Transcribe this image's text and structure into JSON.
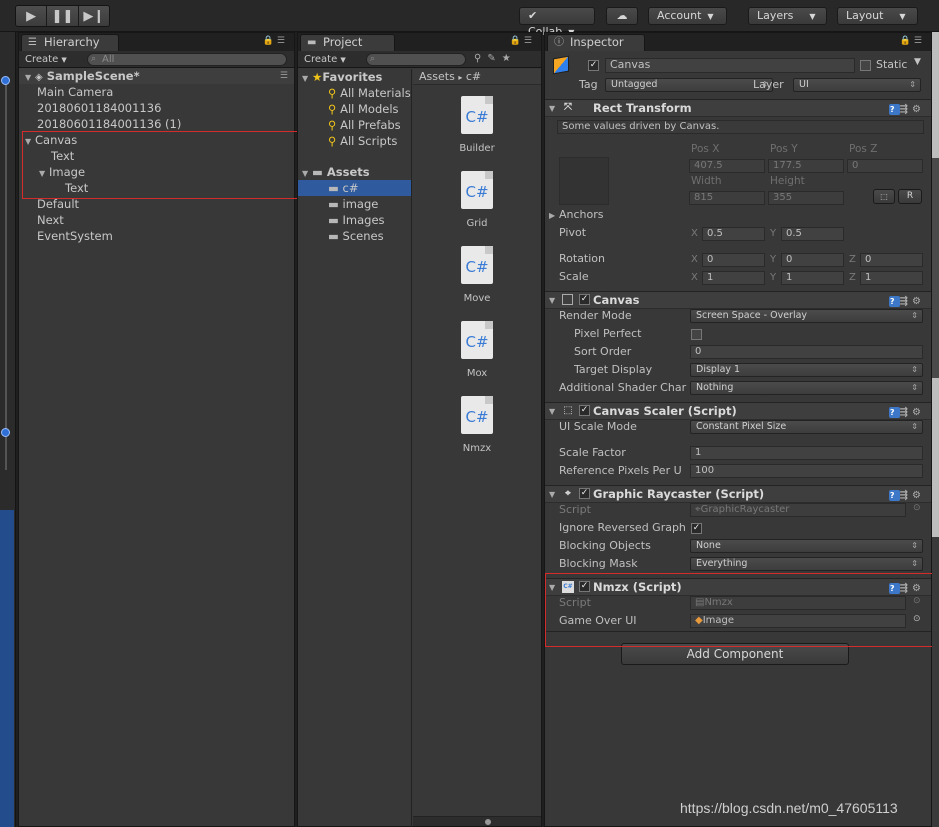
{
  "toolbar": {
    "collab": "Collab",
    "account": "Account",
    "layers": "Layers",
    "layout": "Layout"
  },
  "hierarchy": {
    "tab": "Hierarchy",
    "create": "Create",
    "search_placeholder": "All",
    "scene": "SampleScene*",
    "items": [
      {
        "label": "Main Camera",
        "indent": 0
      },
      {
        "label": "20180601184001136",
        "indent": 0
      },
      {
        "label": "20180601184001136 (1)",
        "indent": 0
      },
      {
        "label": "Canvas",
        "indent": 0
      },
      {
        "label": "Text",
        "indent": 1
      },
      {
        "label": "Image",
        "indent": 1
      },
      {
        "label": "Text",
        "indent": 2
      },
      {
        "label": "Default",
        "indent": 0
      },
      {
        "label": "Next",
        "indent": 0
      },
      {
        "label": "EventSystem",
        "indent": 0
      }
    ]
  },
  "project": {
    "tab": "Project",
    "create": "Create",
    "favorites_label": "Favorites",
    "favorites": [
      "All Materials",
      "All Models",
      "All Prefabs",
      "All Scripts"
    ],
    "assets_label": "Assets",
    "folders": [
      "c#",
      "image",
      "Images",
      "Scenes"
    ],
    "breadcrumb_root": "Assets",
    "breadcrumb_current": "c#",
    "files": [
      "Builder",
      "Grid",
      "Move",
      "Mox",
      "Nmzx"
    ],
    "file_glyph": "C#"
  },
  "inspector": {
    "tab": "Inspector",
    "object_name": "Canvas",
    "static_label": "Static",
    "tag_label": "Tag",
    "tag_value": "Untagged",
    "layer_label": "Layer",
    "layer_value": "UI",
    "rect_transform": {
      "title": "Rect Transform",
      "note": "Some values driven by Canvas.",
      "posx_label": "Pos X",
      "posy_label": "Pos Y",
      "posz_label": "Pos Z",
      "posx": "407.5",
      "posy": "177.5",
      "posz": "0",
      "width_label": "Width",
      "height_label": "Height",
      "width": "815",
      "height": "355",
      "r_button": "R",
      "anchors": "Anchors",
      "pivot_label": "Pivot",
      "pivot_x": "0.5",
      "pivot_y": "0.5",
      "rotation_label": "Rotation",
      "rot_x": "0",
      "rot_y": "0",
      "rot_z": "0",
      "scale_label": "Scale",
      "scale_x": "1",
      "scale_y": "1",
      "scale_z": "1"
    },
    "canvas": {
      "title": "Canvas",
      "render_mode_label": "Render Mode",
      "render_mode": "Screen Space - Overlay",
      "pixel_perfect_label": "Pixel Perfect",
      "sort_order_label": "Sort Order",
      "sort_order": "0",
      "target_display_label": "Target Display",
      "target_display": "Display 1",
      "additional_label": "Additional Shader Char",
      "additional": "Nothing"
    },
    "canvas_scaler": {
      "title": "Canvas Scaler (Script)",
      "ui_scale_label": "UI Scale Mode",
      "ui_scale": "Constant Pixel Size",
      "scale_factor_label": "Scale Factor",
      "scale_factor": "1",
      "ref_ppu_label": "Reference Pixels Per U",
      "ref_ppu": "100"
    },
    "graphic_raycaster": {
      "title": "Graphic Raycaster (Script)",
      "script_label": "Script",
      "script": "GraphicRaycaster",
      "ignore_label": "Ignore Reversed Graph",
      "blocking_objects_label": "Blocking Objects",
      "blocking_objects": "None",
      "blocking_mask_label": "Blocking Mask",
      "blocking_mask": "Everything"
    },
    "nmzx": {
      "title": "Nmzx (Script)",
      "script_label": "Script",
      "script": "Nmzx",
      "game_over_label": "Game Over UI",
      "game_over": "Image"
    },
    "add_component": "Add Component",
    "axis_x": "X",
    "axis_y": "Y",
    "axis_z": "Z"
  },
  "watermark": "https://blog.csdn.net/m0_47605113",
  "colors": {
    "highlight_box": "#d62b2b",
    "selection": "#2f5a9e",
    "csharp_blue": "#3a7bd5"
  }
}
